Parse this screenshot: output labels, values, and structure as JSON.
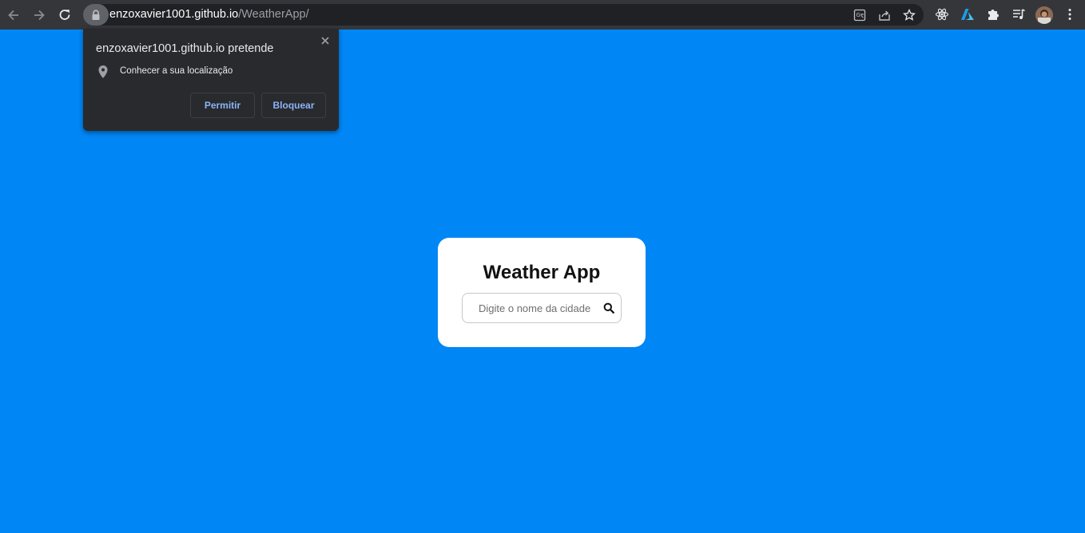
{
  "browser": {
    "url_host": "enzoxavier1001.github.io",
    "url_path": "/WeatherApp/",
    "icons": {
      "back": "back-arrow-icon",
      "forward": "forward-arrow-icon",
      "reload": "reload-icon",
      "lock": "lock-icon",
      "translate": "translate-icon",
      "share": "share-icon",
      "bookmark": "star-icon",
      "extension_react": "react-devtools-icon",
      "extension_azure": "azure-icon",
      "extensions": "puzzle-icon",
      "reading_list": "reading-list-icon",
      "menu": "kebab-menu-icon"
    }
  },
  "permission_popup": {
    "title": "enzoxavier1001.github.io pretende",
    "request_text": "Conhecer a sua localização",
    "allow_label": "Permitir",
    "block_label": "Bloquear",
    "icons": {
      "location": "location-pin-icon",
      "close": "close-icon"
    }
  },
  "weather_app": {
    "title": "Weather App",
    "search_placeholder": "Digite o nome da cidade",
    "search_value": "",
    "search_icon": "search-icon"
  },
  "colors": {
    "page_background": "#0086f5",
    "toolbar_background": "#35363a",
    "popup_background": "#292a2d",
    "popup_button_text": "#8ab4f8",
    "card_background": "#ffffff"
  }
}
